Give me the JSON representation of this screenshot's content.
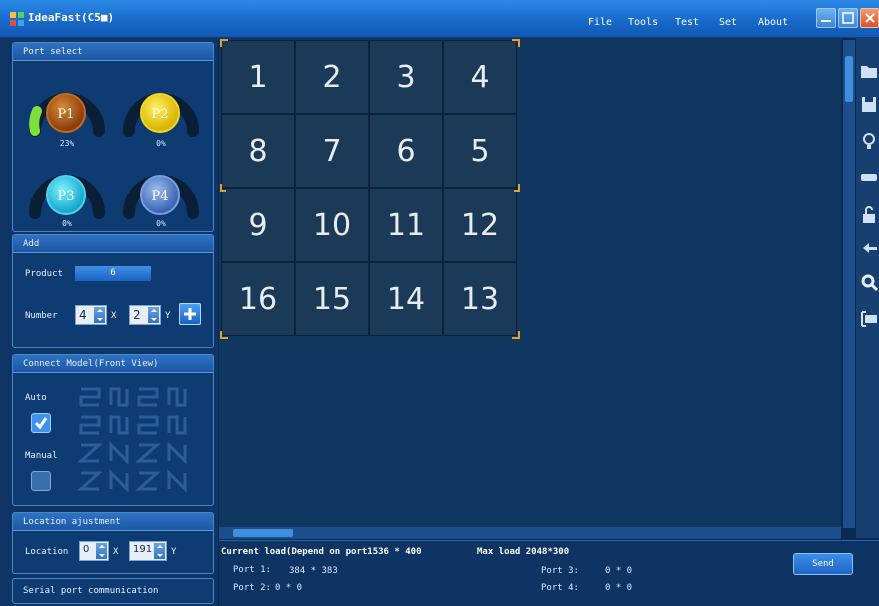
{
  "titlebar": {
    "title": "IdeaFast(C5■)",
    "menu": [
      "File",
      "Tools",
      "Test",
      "Set",
      "About"
    ]
  },
  "port_select": {
    "heading": "Port select",
    "ports": [
      {
        "label": "P1",
        "percent": "23%",
        "color": "#9b4a0c",
        "level": 0.23
      },
      {
        "label": "P2",
        "percent": "0%",
        "color": "#e8c915",
        "level": 0
      },
      {
        "label": "P3",
        "percent": "0%",
        "color": "#21b8d8",
        "level": 0
      },
      {
        "label": "P4",
        "percent": "0%",
        "color": "#4a78c2",
        "level": 0
      }
    ]
  },
  "add": {
    "heading": "Add",
    "product_label": "Product",
    "product_value": "6",
    "number_label": "Number",
    "x_value": "4",
    "x_label": "X",
    "y_value": "2",
    "y_label": "Y"
  },
  "connect_model": {
    "heading": "Connect Model(Front View)",
    "auto_label": "Auto",
    "auto_checked": true,
    "manual_label": "Manual",
    "manual_checked": false
  },
  "location": {
    "heading": "Location ajustment",
    "label": "Location",
    "x_value": "0",
    "x_label": "X",
    "y_value": "191",
    "y_label": "Y"
  },
  "serial": {
    "heading": "Serial port communication"
  },
  "grid": {
    "rows": [
      [
        "1",
        "2",
        "3",
        "4"
      ],
      [
        "8",
        "7",
        "6",
        "5"
      ],
      [
        "9",
        "10",
        "11",
        "12"
      ],
      [
        "16",
        "15",
        "14",
        "13"
      ]
    ]
  },
  "status": {
    "current_load": "Current load(Depend on port1536 * 400",
    "max_load": "Max load 2048*300",
    "port1_label": "Port 1:",
    "port1_value": "384 * 383",
    "port2_label": "Port 2:",
    "port2_value": "0 * 0",
    "port3_label": "Port 3:",
    "port3_value": "0 * 0",
    "port4_label": "Port 4:",
    "port4_value": "0 * 0",
    "send_label": "Send"
  },
  "toolbar": [
    "folder-icon",
    "save-icon",
    "bulb-icon",
    "usb-icon",
    "lock-icon",
    "undo-icon",
    "search-icon",
    "screen-icon"
  ]
}
